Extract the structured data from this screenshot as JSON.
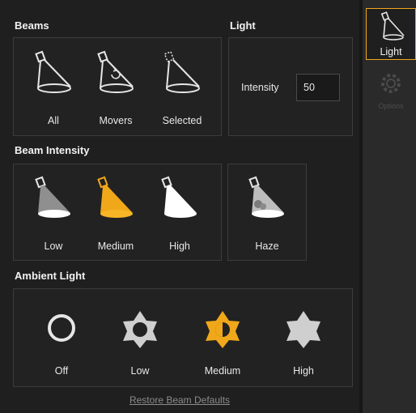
{
  "sections": {
    "beams": {
      "heading": "Beams",
      "items": [
        {
          "label": "All"
        },
        {
          "label": "Movers"
        },
        {
          "label": "Selected"
        }
      ]
    },
    "light": {
      "heading": "Light",
      "intensity_label": "Intensity",
      "intensity_value": "50"
    },
    "beam_intensity": {
      "heading": "Beam Intensity",
      "items": [
        {
          "label": "Low"
        },
        {
          "label": "Medium"
        },
        {
          "label": "High"
        },
        {
          "label": "Haze"
        }
      ],
      "selected": "Medium"
    },
    "ambient_light": {
      "heading": "Ambient Light",
      "items": [
        {
          "label": "Off"
        },
        {
          "label": "Low"
        },
        {
          "label": "Medium"
        },
        {
          "label": "High"
        }
      ],
      "selected": "Medium"
    }
  },
  "footer": {
    "restore_link": "Restore Beam Defaults"
  },
  "sidebar": {
    "tabs": [
      {
        "label": "Light",
        "icon": "spotlight-icon",
        "active": true
      },
      {
        "label": "Options",
        "icon": "gear-icon",
        "active": false
      }
    ]
  },
  "colors": {
    "accent": "#f0a81a",
    "background": "#1f1f1f",
    "panel_border": "#3c3c3c"
  }
}
